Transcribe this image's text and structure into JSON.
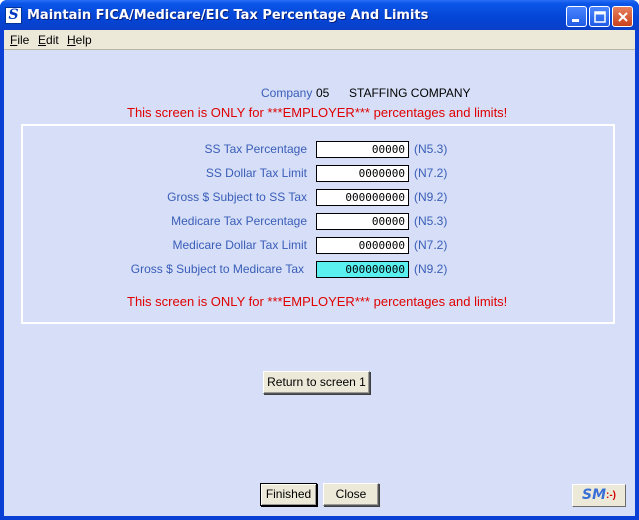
{
  "window": {
    "title": "Maintain FICA/Medicare/EIC Tax Percentage And Limits",
    "app_icon_letter": "S"
  },
  "menu": [
    {
      "label": "File",
      "mnemonic": "F",
      "rest": "ile"
    },
    {
      "label": "Edit",
      "mnemonic": "E",
      "rest": "dit"
    },
    {
      "label": "Help",
      "mnemonic": "H",
      "rest": "elp"
    }
  ],
  "company": {
    "label": "Company",
    "code": "05",
    "name": "STAFFING COMPANY"
  },
  "warning_top": "This screen is ONLY for ***EMPLOYER*** percentages and limits!",
  "warning_bottom": "This screen is ONLY for ***EMPLOYER*** percentages and limits!",
  "fields": [
    {
      "label": "SS Tax Percentage",
      "value": "00000",
      "format": "(N5.3)",
      "active": false
    },
    {
      "label": "SS Dollar Tax Limit",
      "value": "0000000",
      "format": "(N7.2)",
      "active": false
    },
    {
      "label": "Gross $ Subject to SS Tax",
      "value": "000000000",
      "format": "(N9.2)",
      "active": false
    },
    {
      "label": "Medicare Tax Percentage",
      "value": "00000",
      "format": "(N5.3)",
      "active": false
    },
    {
      "label": "Medicare Dollar Tax Limit",
      "value": "0000000",
      "format": "(N7.2)",
      "active": false
    },
    {
      "label": "Gross $ Subject to Medicare Tax",
      "value": "000000000",
      "format": "(N9.2)",
      "active": true
    }
  ],
  "buttons": {
    "return": "Return to screen 1",
    "finished": "Finished",
    "close": "Close"
  },
  "logo": {
    "text": "SM",
    "face": ":-)"
  },
  "colors": {
    "title_bar": "#0a56e8",
    "client_bg": "#d6dff7",
    "label_blue": "#3a5db8",
    "warning_red": "#e00000",
    "active_field": "#5af0f0"
  }
}
